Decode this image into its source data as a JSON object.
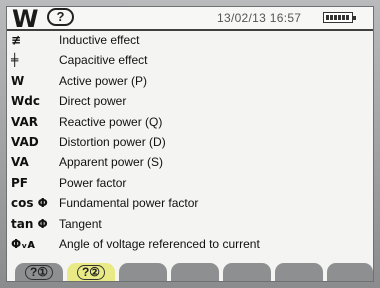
{
  "header": {
    "mode_symbol": "W",
    "help_symbol": "?",
    "datetime": "13/02/13 16:57"
  },
  "items": [
    {
      "symbol": "≢",
      "label": "Inductive effect",
      "icon": "inductive-effect-icon"
    },
    {
      "symbol": "╪",
      "label": "Capacitive effect",
      "icon": "capacitive-effect-icon"
    },
    {
      "symbol": "W",
      "label": "Active power (P)"
    },
    {
      "symbol": "Wdc",
      "label": "Direct power"
    },
    {
      "symbol": "VAR",
      "label": "Reactive power (Q)"
    },
    {
      "symbol": "VAD",
      "label": "Distortion power (D)"
    },
    {
      "symbol": "VA",
      "label": "Apparent power (S)"
    },
    {
      "symbol": "PF",
      "label": "Power factor"
    },
    {
      "symbol": "cos Φ",
      "label": "Fundamental power factor"
    },
    {
      "symbol": "tan Φ",
      "label": "Tangent"
    },
    {
      "symbol": "Φᵥᴀ",
      "label": "Angle of voltage referenced to current"
    }
  ],
  "tabs": [
    {
      "label": "?①",
      "active": false
    },
    {
      "label": "?②",
      "active": true
    },
    {
      "label": "",
      "active": false
    },
    {
      "label": "",
      "active": false
    },
    {
      "label": "",
      "active": false
    },
    {
      "label": "",
      "active": false
    },
    {
      "label": "",
      "active": false
    }
  ],
  "colors": {
    "screen_bg": "#f4f4f2",
    "active_tab": "#e9ea86",
    "inactive_tab": "#8d8f90"
  }
}
